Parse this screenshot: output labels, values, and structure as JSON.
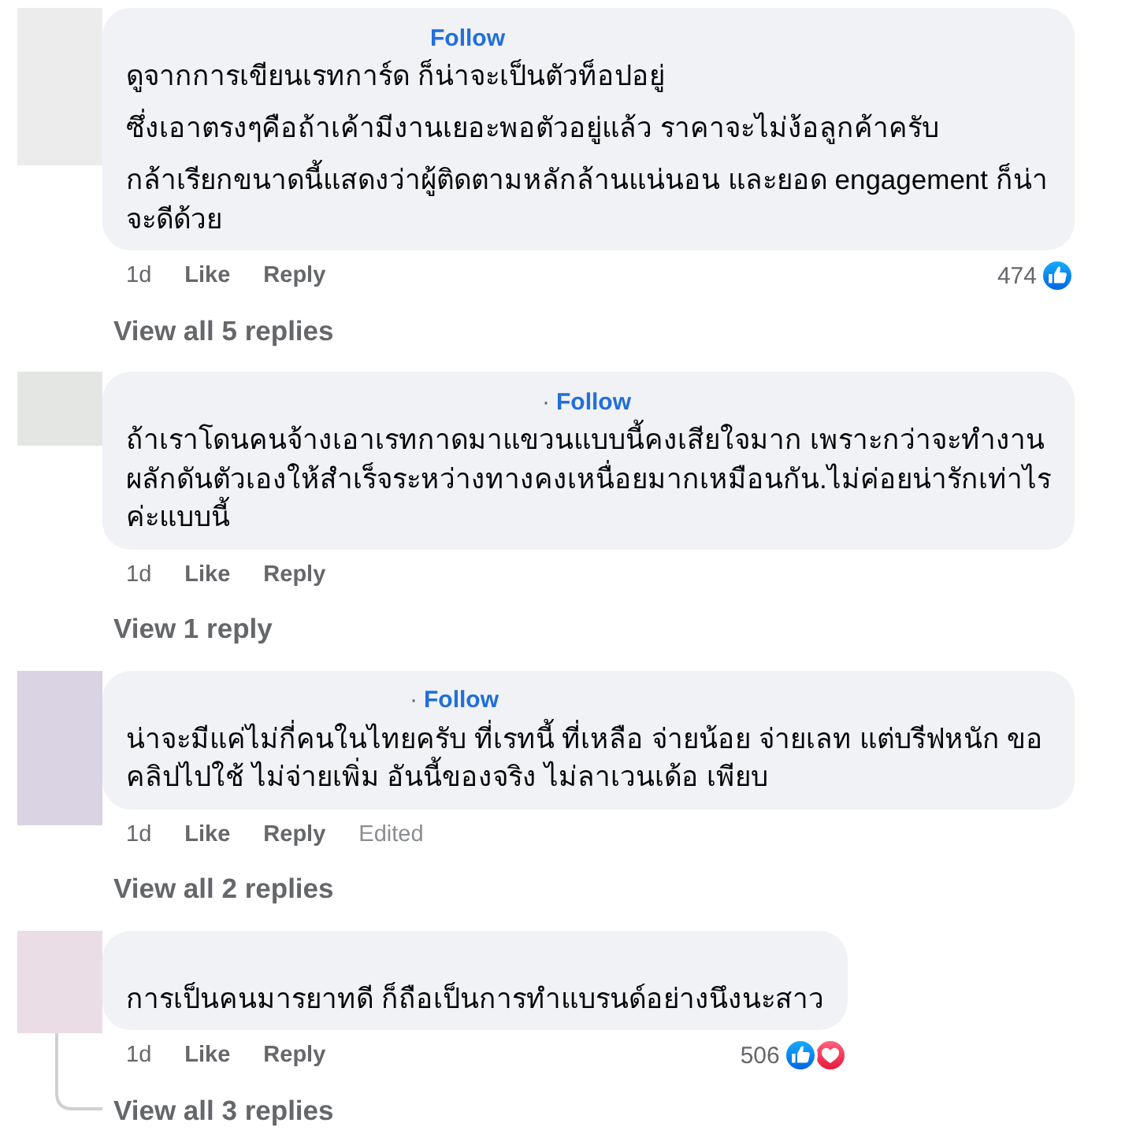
{
  "comments": [
    {
      "avatar": {
        "color": "#ececec"
      },
      "header": {
        "follow": "Follow"
      },
      "body": [
        "ดูจากการเขียนเรทการ์ด ก็น่าจะเป็นตัวท็อปอยู่",
        "ซึ่งเอาตรงๆคือถ้าเค้ามีงานเยอะพอตัวอยู่แล้ว ราคาจะไม่ง้อลูกค้าครับ",
        "กล้าเรียกขนาดนี้แสดงว่าผู้ติดตามหลักล้านแน่นอน และยอด engagement ก็น่าจะดีด้วย"
      ],
      "time": "1d",
      "actions": [
        "Like",
        "Reply"
      ],
      "reactions": {
        "count": "474",
        "icons": [
          {
            "kind": "like"
          }
        ]
      },
      "replies_link": "View all 5 replies"
    },
    {
      "avatar": {
        "color": "#e4e6e4"
      },
      "header": {
        "separator": "·",
        "follow": "Follow"
      },
      "body": [
        "ถ้าเราโดนคนจ้างเอาเรทกาดมาแขวนแบบนี้คงเสียใจมาก เพราะกว่าจะทำงานผลักดันตัวเองให้สำเร็จระหว่างทางคงเหนื่อยมากเหมือนกัน.ไม่ค่อยน่ารักเท่าไรค่ะแบบนี้"
      ],
      "time": "1d",
      "actions": [
        "Like",
        "Reply"
      ],
      "replies_link": "View 1 reply"
    },
    {
      "avatar": {
        "color": "#d9d3e3"
      },
      "header": {
        "separator": "·",
        "follow": "Follow"
      },
      "body": [
        "น่าจะมีแค่ไม่กี่คนในไทยครับ ที่เรทนี้ ที่เหลือ จ่ายน้อย จ่ายเลท แต่บรีฟหนัก ขอคลิปไปใช้ ไม่จ่ายเพิ่ม อันนี้ของจริง ไม่ลาเวนเด้อ เพียบ"
      ],
      "time": "1d",
      "actions": [
        "Like",
        "Reply"
      ],
      "edited": "Edited",
      "replies_link": "View all 2 replies"
    },
    {
      "avatar": {
        "color": "#ebdde6"
      },
      "body": [
        "การเป็นคนมารยาทดี ก็ถือเป็นการทำแบรนด์อย่างนึงนะสาว"
      ],
      "time": "1d",
      "actions": [
        "Like",
        "Reply"
      ],
      "reactions": {
        "count": "506",
        "icons": [
          {
            "kind": "like"
          },
          {
            "kind": "love"
          }
        ]
      },
      "replies_link": "View all 3 replies"
    }
  ]
}
